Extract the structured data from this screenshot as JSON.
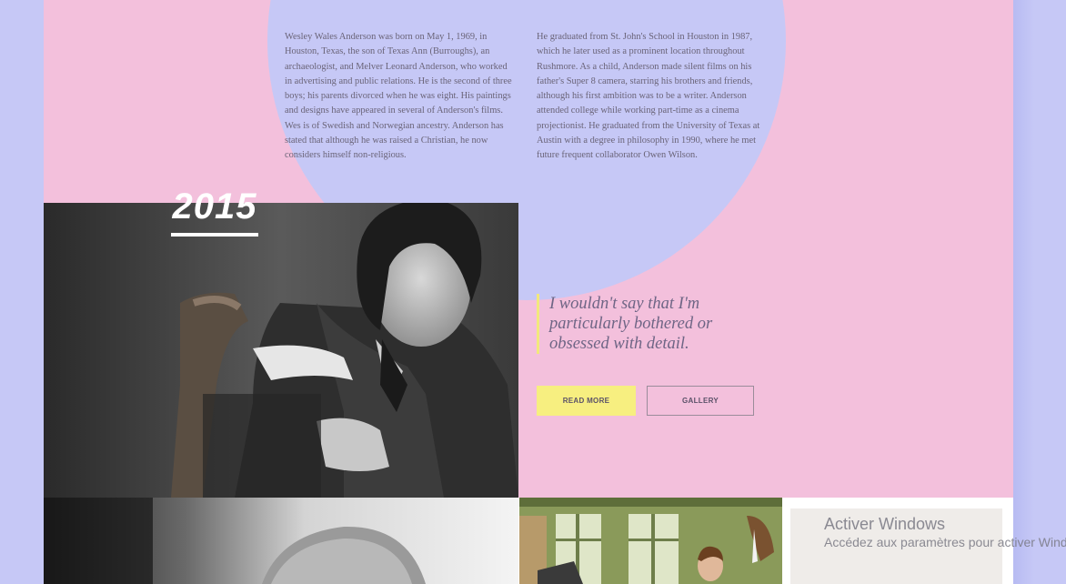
{
  "bio": {
    "col1": "Wesley Wales Anderson was born on May 1, 1969, in Houston, Texas, the son of Texas Ann (Burroughs), an archaeologist, and Melver Leonard Anderson, who worked in advertising and public relations. He is the second of three boys; his parents divorced when he was eight. His paintings and designs have appeared in several of Anderson's films. Wes is of Swedish and Norwegian ancestry. Anderson has stated that although he was raised a Christian, he now considers himself non-religious.",
    "col2": "He graduated from St. John's School in Houston in 1987, which he later used as a prominent location throughout Rushmore. As a child, Anderson made silent films on his father's Super 8 camera, starring his brothers and friends, although his first ambition was to be a writer. Anderson attended college while working part-time as a cinema projectionist. He graduated from the University of Texas at Austin with a degree in philosophy in 1990, where he met future frequent collaborator Owen Wilson."
  },
  "feature": {
    "year": "2015",
    "quote": "I wouldn't say that I'm particularly bothered or obsessed with detail.",
    "read_more_label": "READ MORE",
    "gallery_label": "GALLERY"
  },
  "windows_notice": {
    "title": "Activer Windows",
    "subtitle": "Accédez aux paramètres pour activer Windows."
  },
  "colors": {
    "page_background": "#f3c0dc",
    "circle": "#c6c8f6",
    "accent_yellow": "#f7ef80"
  }
}
